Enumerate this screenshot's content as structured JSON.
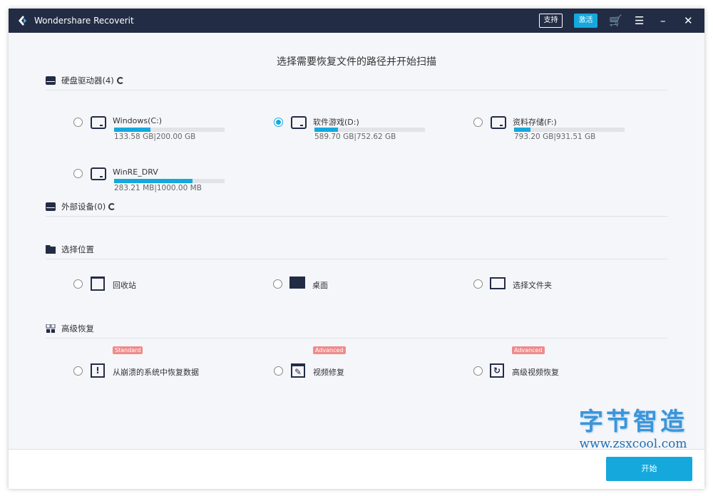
{
  "titlebar": {
    "title": "Wondershare Recoverit",
    "support": "支持",
    "activate": "激活",
    "cart_icon": "cart-icon",
    "menu_icon": "menu-icon",
    "minimize_icon": "minimize-icon",
    "close_icon": "close-icon",
    "cart": "🛒",
    "menu": "☰",
    "minimize": "–",
    "close": "✕"
  },
  "heading": "选择需要恢复文件的路径并开始扫描",
  "hard_drives": {
    "title": "硬盘驱动器(4)",
    "drives": [
      {
        "name": "Windows(C:)",
        "size": "133.58 GB|200.00 GB",
        "used_fraction": 0.33,
        "selected": false
      },
      {
        "name": "软件游戏(D:)",
        "size": "589.70 GB|752.62 GB",
        "used_fraction": 0.21,
        "selected": true
      },
      {
        "name": "资料存储(F:)",
        "size": "793.20 GB|931.51 GB",
        "used_fraction": 0.15,
        "selected": false
      },
      {
        "name": "WinRE_DRV",
        "size": "283.21 MB|1000.00 MB",
        "used_fraction": 0.71,
        "selected": false
      }
    ]
  },
  "external": {
    "title": "外部设备(0)"
  },
  "locations": {
    "title": "选择位置",
    "items": [
      {
        "label": "回收站"
      },
      {
        "label": "桌面"
      },
      {
        "label": "选择文件夹"
      }
    ]
  },
  "advanced": {
    "title": "高级恢复",
    "items": [
      {
        "label": "从崩溃的系统中恢复数据",
        "badge": "Standard"
      },
      {
        "label": "视频修复",
        "badge": "Advanced"
      },
      {
        "label": "高级视频恢复",
        "badge": "Advanced"
      }
    ]
  },
  "footer": {
    "start": "开始"
  },
  "watermark": {
    "title": "字节智造",
    "url": "www.zsxcool.com"
  },
  "colors": {
    "accent": "#14a8dd",
    "titlebar": "#232c45",
    "badge": "#f08a8a"
  }
}
